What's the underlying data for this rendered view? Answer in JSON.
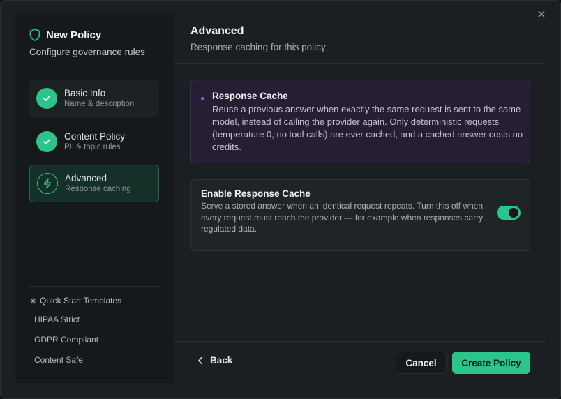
{
  "dialog": {
    "close_icon": "close-icon"
  },
  "sidebar": {
    "title": "New Policy",
    "subtitle": "Configure governance rules",
    "steps": [
      {
        "label": "Basic Info",
        "description": "Name & description",
        "state": "done",
        "icon": "check-icon"
      },
      {
        "label": "Content Policy",
        "description": "PII & topic rules",
        "state": "done",
        "icon": "check-icon"
      },
      {
        "label": "Advanced",
        "description": "Response caching",
        "state": "active",
        "icon": "lightning-icon"
      }
    ],
    "quick_start": {
      "title": "Quick Start Templates",
      "templates": [
        "HIPAA Strict",
        "GDPR Compliant",
        "Content Safe"
      ]
    }
  },
  "main": {
    "title": "Advanced",
    "subtitle": "Response caching for this policy",
    "info": {
      "title": "Response Cache",
      "body": "Reuse a previous answer when exactly the same request is sent to the same model, instead of calling the provider again. Only deterministic requests (temperature 0, no tool calls) are ever cached, and a cached answer costs no credits."
    },
    "setting": {
      "title": "Enable Response Cache",
      "body": "Serve a stored answer when an identical request repeats. Turn this off when every request must reach the provider — for example when responses carry regulated data.",
      "enabled": true
    }
  },
  "footer": {
    "back_label": "Back",
    "cancel_label": "Cancel",
    "create_label": "Create Policy"
  },
  "colors": {
    "accent": "#2bc48a",
    "info_bg": "#261f33",
    "info_dot": "#8a57d9"
  }
}
